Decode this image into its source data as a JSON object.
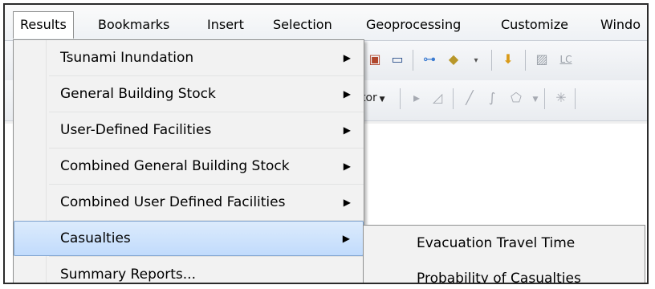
{
  "menubar": {
    "items": [
      {
        "label": "Results"
      },
      {
        "label": "Bookmarks"
      },
      {
        "label": "Insert"
      },
      {
        "label": "Selection"
      },
      {
        "label": "Geoprocessing"
      },
      {
        "label": "Customize"
      },
      {
        "label": "Windo"
      }
    ]
  },
  "toolbar": {
    "editor_label": "tor",
    "lc_label": "LC"
  },
  "results_menu": {
    "items": [
      {
        "label": "Tsunami Inundation",
        "has_submenu": true
      },
      {
        "label": "General Building Stock",
        "has_submenu": true
      },
      {
        "label": "User-Defined Facilities",
        "has_submenu": true
      },
      {
        "label": "Combined General Building Stock",
        "has_submenu": true
      },
      {
        "label": "Combined User Defined Facilities",
        "has_submenu": true
      },
      {
        "label": "Casualties",
        "has_submenu": true,
        "highlighted": true
      },
      {
        "label": "Summary Reports...",
        "has_submenu": false
      }
    ]
  },
  "casualties_submenu": {
    "items": [
      {
        "label": "Evacuation Travel Time"
      },
      {
        "label": "Probability of Casualties"
      }
    ]
  },
  "colors": {
    "highlight_fill": "#c1dbfc",
    "highlight_border": "#7da2ce",
    "menu_bg": "#f2f2f2"
  }
}
